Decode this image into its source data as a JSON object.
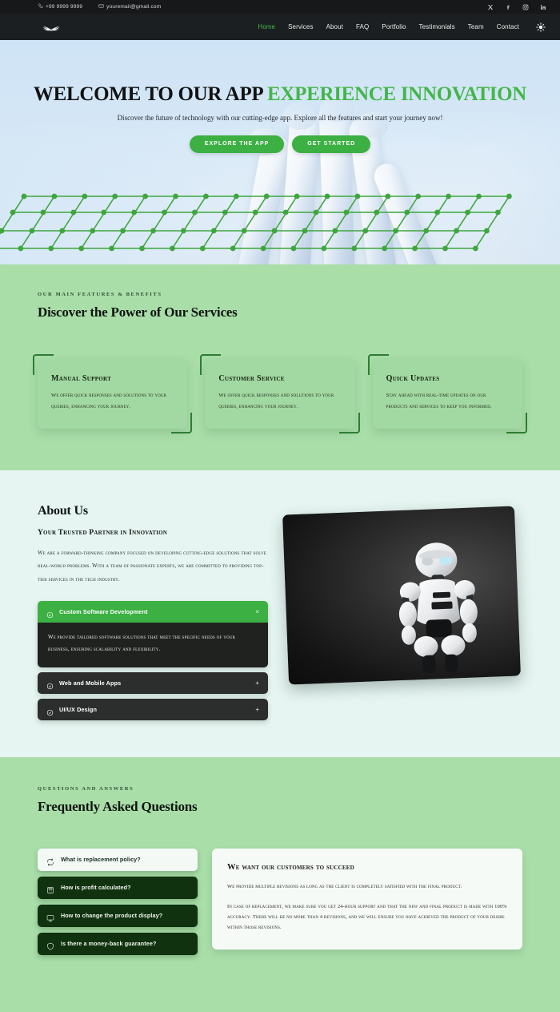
{
  "topbar": {
    "phone": "+99 9999 9999",
    "email": "youremail@gmail.com",
    "phone_icon": "phone-icon",
    "email_icon": "envelope-icon",
    "socials": [
      {
        "name": "x-icon",
        "label": "x"
      },
      {
        "name": "facebook-icon",
        "label": "f"
      },
      {
        "name": "instagram-icon",
        "label": "ig"
      },
      {
        "name": "linkedin-icon",
        "label": "in"
      }
    ]
  },
  "nav": {
    "logo_icon": "wings-logo-icon",
    "theme_icon": "sun-icon",
    "active": "Home",
    "links": [
      {
        "label": "Home"
      },
      {
        "label": "Services"
      },
      {
        "label": "About"
      },
      {
        "label": "FAQ"
      },
      {
        "label": "Portfolio"
      },
      {
        "label": "Testimonials"
      },
      {
        "label": "Team"
      },
      {
        "label": "Contact"
      }
    ]
  },
  "hero": {
    "title_dark": "WELCOME TO OUR APP",
    "title_accent": "EXPERIENCE INNOVATION",
    "subtitle": "Discover the future of technology with our cutting-edge app. Explore all the features and start your journey now!",
    "primary_button": "EXPLORE THE APP",
    "secondary_button": "GET STARTED",
    "background_image": "robot-hand-photo",
    "decor": "green-lattice-network-graphic"
  },
  "services": {
    "eyebrow": "OUR MAIN FEATURES & BENEFITS",
    "title": "Discover the Power of Our Services",
    "cards": [
      {
        "title": "Manual Support",
        "text": "We offer quick responses and solutions to your queries, enhancing your journey."
      },
      {
        "title": "Customer Service",
        "text": "We offer quick responses and solutions to your queries, enhancing your journey."
      },
      {
        "title": "Quick Updates",
        "text": "Stay ahead with real-time updates on our products and services to keep you informed."
      }
    ]
  },
  "about": {
    "title": "About Us",
    "subtitle": "Your Trusted Partner in Innovation",
    "paragraph": "We are a forward-thinking company focused on developing cutting-edge solutions that solve real-world problems. With a team of passionate experts, we are committed to providing top-tier services in the tech industry.",
    "image": "white-humanoid-robot-photo",
    "accordion": [
      {
        "label": "Custom Software Development",
        "open": true,
        "sign": "×",
        "body": "We provide tailored software solutions that meet the specific needs of your business, ensuring scalability and flexibility."
      },
      {
        "label": "Web and Mobile Apps",
        "open": false,
        "sign": "+",
        "body": ""
      },
      {
        "label": "UI/UX Design",
        "open": false,
        "sign": "+",
        "body": ""
      }
    ]
  },
  "faq": {
    "eyebrow": "QUESTIONS AND ANSWERS",
    "title": "Frequently Asked Questions",
    "tabs": [
      {
        "label": "What is replacement policy?",
        "icon": "refresh-arrow-icon",
        "active": true
      },
      {
        "label": "How is profit calculated?",
        "icon": "calculator-icon",
        "active": false
      },
      {
        "label": "How to change the product display?",
        "icon": "monitor-icon",
        "active": false
      },
      {
        "label": "Is there a money-back guarantee?",
        "icon": "shield-icon",
        "active": false
      }
    ],
    "panel": {
      "heading": "We want our customers to succeed",
      "paragraph1": "We provide multiple revisions as long as the client is completely satisfied with the final product.",
      "paragraph2": "In case of replacement, we make sure you get 24-hour support and that the new and final product is made with 100% accuracy. There will be no more than 4 revisions, and we will ensure you have achieved the product of your desire within those revisions."
    }
  },
  "colors": {
    "accent_green": "#3cb043",
    "nav_dark": "#1c1f21",
    "section_green": "#a9dea9",
    "section_mint": "#e6f5f1",
    "faq_tab_dark": "#10320f"
  }
}
